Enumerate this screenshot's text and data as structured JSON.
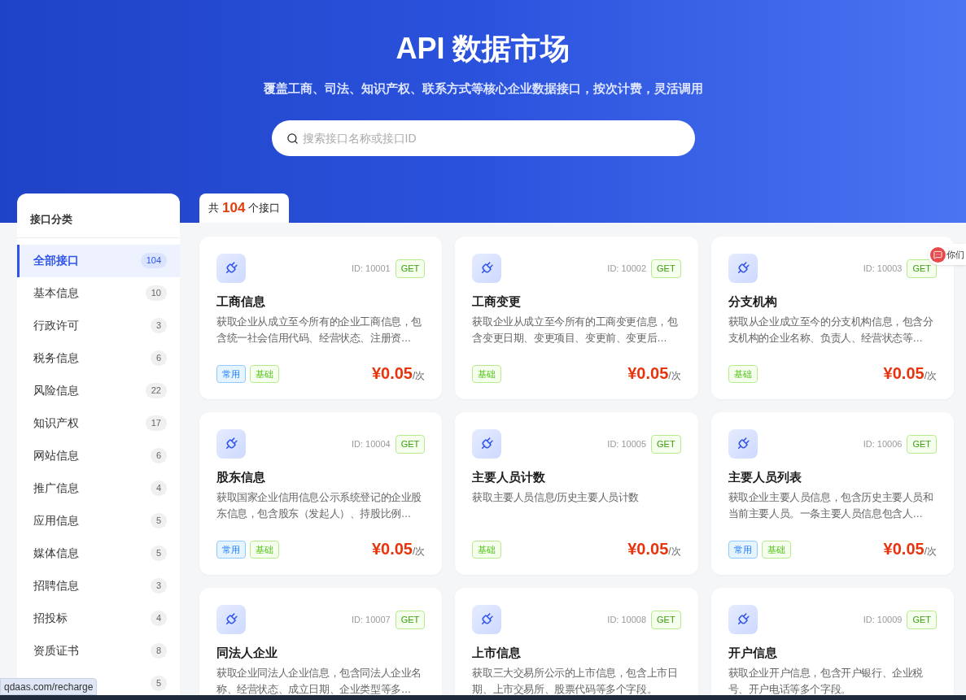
{
  "hero": {
    "title": "API 数据市场",
    "subtitle": "覆盖工商、司法、知识产权、联系方式等核心企业数据接口，按次计费，灵活调用",
    "search": {
      "placeholder": "搜索接口名称或接口ID"
    }
  },
  "sidebar": {
    "title": "接口分类",
    "items": [
      {
        "label": "全部接口",
        "count": "104",
        "selected": true
      },
      {
        "label": "基本信息",
        "count": "10",
        "selected": false
      },
      {
        "label": "行政许可",
        "count": "3",
        "selected": false
      },
      {
        "label": "税务信息",
        "count": "6",
        "selected": false
      },
      {
        "label": "风险信息",
        "count": "22",
        "selected": false
      },
      {
        "label": "知识产权",
        "count": "17",
        "selected": false
      },
      {
        "label": "网站信息",
        "count": "6",
        "selected": false
      },
      {
        "label": "推广信息",
        "count": "4",
        "selected": false
      },
      {
        "label": "应用信息",
        "count": "5",
        "selected": false
      },
      {
        "label": "媒体信息",
        "count": "5",
        "selected": false
      },
      {
        "label": "招聘信息",
        "count": "3",
        "selected": false
      },
      {
        "label": "招投标",
        "count": "4",
        "selected": false
      },
      {
        "label": "资质证书",
        "count": "8",
        "selected": false
      },
      {
        "count": "5",
        "selected": false
      }
    ]
  },
  "summary": {
    "prefix": "共",
    "count": "104",
    "suffix": "个接口"
  },
  "apis": [
    {
      "id": "ID: 10001",
      "method": "GET",
      "name": "工商信息",
      "description": "获取企业从成立至今所有的企业工商信息，包含统一社会信用代码、经营状态、注册资…",
      "tags": [
        {
          "text": "常用",
          "kind": "common"
        },
        {
          "text": "基础",
          "kind": "basic"
        }
      ],
      "price": "¥0.05",
      "unit": "/次"
    },
    {
      "id": "ID: 10002",
      "method": "GET",
      "name": "工商变更",
      "description": "获取企业从成立至今所有的工商变更信息，包含变更日期、变更项目、变更前、变更后…",
      "tags": [
        {
          "text": "基础",
          "kind": "basic"
        }
      ],
      "price": "¥0.05",
      "unit": "/次"
    },
    {
      "id": "ID: 10003",
      "method": "GET",
      "name": "分支机构",
      "description": "获取从企业成立至今的分支机构信息，包含分支机构的企业名称、负责人、经营状态等…",
      "tags": [
        {
          "text": "基础",
          "kind": "basic"
        }
      ],
      "price": "¥0.05",
      "unit": "/次"
    },
    {
      "id": "ID: 10004",
      "method": "GET",
      "name": "股东信息",
      "description": "获取国家企业信用信息公示系统登记的企业股东信息，包含股东（发起人）、持股比例…",
      "tags": [
        {
          "text": "常用",
          "kind": "common"
        },
        {
          "text": "基础",
          "kind": "basic"
        }
      ],
      "price": "¥0.05",
      "unit": "/次"
    },
    {
      "id": "ID: 10005",
      "method": "GET",
      "name": "主要人员计数",
      "description": "获取主要人员信息/历史主要人员计数",
      "tags": [
        {
          "text": "基础",
          "kind": "basic"
        }
      ],
      "price": "¥0.05",
      "unit": "/次"
    },
    {
      "id": "ID: 10006",
      "method": "GET",
      "name": "主要人员列表",
      "description": "获取企业主要人员信息，包含历史主要人员和当前主要人员。一条主要人员信息包含人…",
      "tags": [
        {
          "text": "常用",
          "kind": "common"
        },
        {
          "text": "基础",
          "kind": "basic"
        }
      ],
      "price": "¥0.05",
      "unit": "/次"
    },
    {
      "id": "ID: 10007",
      "method": "GET",
      "name": "同法人企业",
      "description": "获取企业同法人企业信息，包含同法人企业名称、经营状态、成立日期、企业类型等多…"
    },
    {
      "id": "ID: 10008",
      "method": "GET",
      "name": "上市信息",
      "description": "获取三大交易所公示的上市信息，包含上市日期、上市交易所、股票代码等多个字段。"
    },
    {
      "id": "ID: 10009",
      "method": "GET",
      "name": "开户信息",
      "description": "获取企业开户信息，包含开户银行、企业税号、开户电话等多个字段。"
    }
  ],
  "chat_widget": {
    "label": "你们"
  },
  "status_bubble": {
    "url": "qdaas.com/recharge"
  }
}
